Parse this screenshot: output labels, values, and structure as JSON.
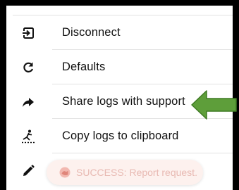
{
  "menu": {
    "items": [
      {
        "label": "Disconnect",
        "icon": "logout-icon"
      },
      {
        "label": "Defaults",
        "icon": "refresh-icon"
      },
      {
        "label": "Share logs with support",
        "icon": "share-arrow-icon"
      },
      {
        "label": "Copy logs to clipboard",
        "icon": "copy-logs-icon"
      },
      {
        "label": "",
        "icon": "pencil-icon"
      }
    ]
  },
  "toast": {
    "text": "SUCCESS: Report request.",
    "icon": "error-badge-icon"
  },
  "annotation": {
    "arrow_color": "#5e9e3a",
    "arrow_outline": "#3f7a24"
  },
  "colors": {
    "frame": "#000000",
    "divider": "#e2e2e2",
    "toast_bg": "#fdf1ee",
    "toast_text": "#e8b9b2"
  }
}
